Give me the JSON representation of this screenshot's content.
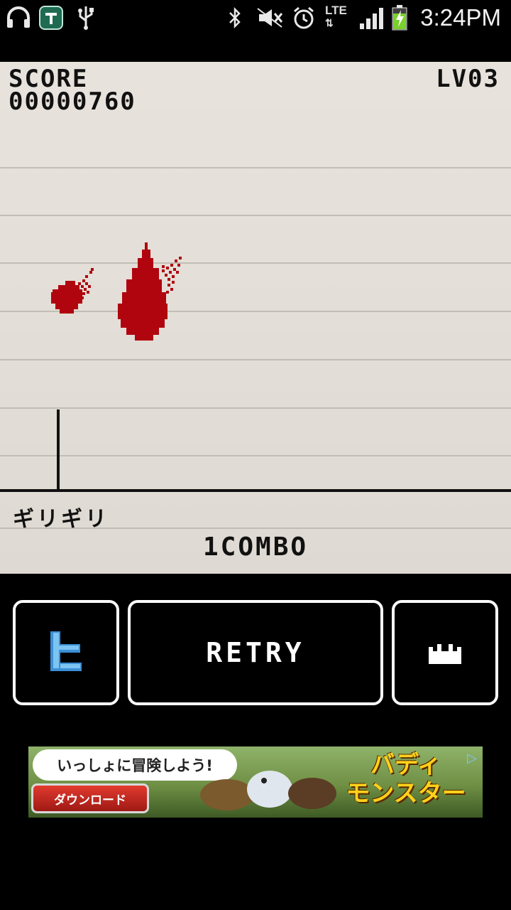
{
  "status_bar": {
    "time": "3:24PM",
    "network": "LTE",
    "icons": [
      "headphones-icon",
      "app-t-icon",
      "usb-icon",
      "bluetooth-icon",
      "mute-icon",
      "alarm-icon",
      "lte-icon",
      "signal-icon",
      "battery-charging-icon"
    ]
  },
  "game": {
    "score_label": "SCORE",
    "score_value": "00000760",
    "level": "LV03",
    "status_text": "ギリギリ",
    "combo": "1COMBO",
    "blood_color": "#b0050f"
  },
  "buttons": {
    "twitter_icon": "twitter-bird-icon",
    "retry": "RETRY",
    "ranking_icon": "crown-icon"
  },
  "ad": {
    "tagline": "いっしょに冒険しよう!",
    "download": "ダウンロード",
    "title_line1": "バディ",
    "title_line2": "モンスター",
    "info_icon": "ad-choices-icon"
  }
}
